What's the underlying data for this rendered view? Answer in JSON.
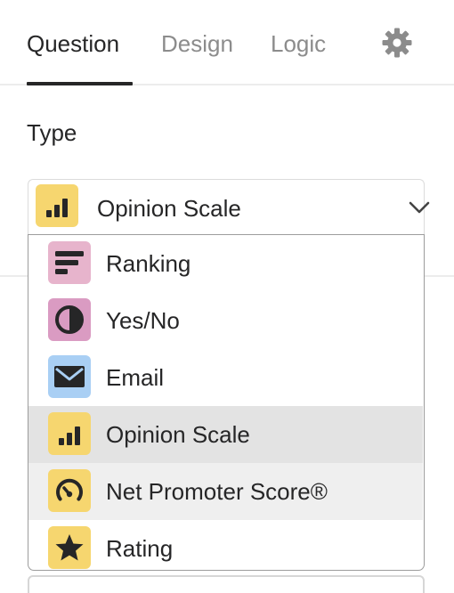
{
  "tabs": [
    {
      "label": "Question",
      "active": true
    },
    {
      "label": "Design",
      "active": false
    },
    {
      "label": "Logic",
      "active": false
    }
  ],
  "settings_icon": "gear-icon",
  "type_label": "Type",
  "select": {
    "value": "Opinion Scale",
    "icon": "bar-chart-icon",
    "icon_color": "#f6d66f",
    "chevron": "chevron-down-icon",
    "expanded": true
  },
  "options": [
    {
      "label": "Ranking",
      "icon": "ranking-icon",
      "icon_color": "#e7b4cc",
      "state": "normal"
    },
    {
      "label": "Yes/No",
      "icon": "yes-no-icon",
      "icon_color": "#da9bc2",
      "state": "normal"
    },
    {
      "label": "Email",
      "icon": "email-icon",
      "icon_color": "#a9cff4",
      "state": "normal"
    },
    {
      "label": "Opinion Scale",
      "icon": "bar-chart-icon",
      "icon_color": "#f6d66f",
      "state": "selected"
    },
    {
      "label": "Net Promoter Score®",
      "icon": "gauge-icon",
      "icon_color": "#f6d66f",
      "state": "hover"
    },
    {
      "label": "Rating",
      "icon": "star-icon",
      "icon_color": "#f6d66f",
      "state": "normal"
    }
  ],
  "colors": {
    "text": "#262627",
    "muted_text": "#8c8c8c",
    "selected_row": "#e3e3e3",
    "hover_row": "#efefef"
  }
}
